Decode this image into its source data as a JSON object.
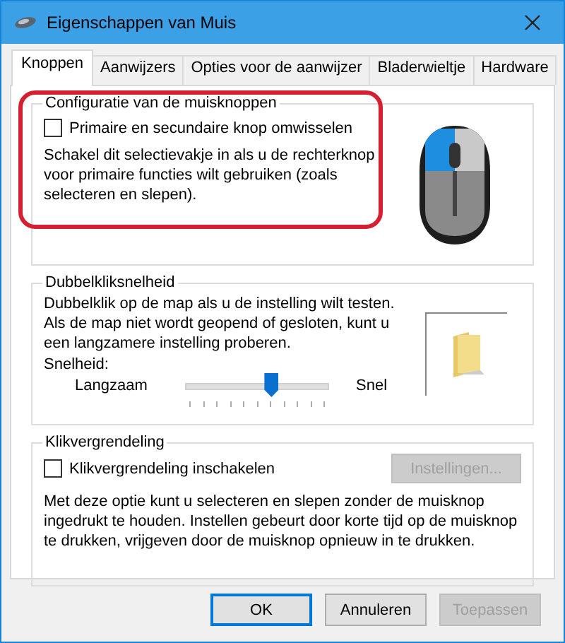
{
  "window": {
    "title": "Eigenschappen van Muis"
  },
  "tabs": [
    {
      "label": "Knoppen",
      "selected": true
    },
    {
      "label": "Aanwijzers",
      "selected": false
    },
    {
      "label": "Opties voor de aanwijzer",
      "selected": false
    },
    {
      "label": "Bladerwieltje",
      "selected": false
    },
    {
      "label": "Hardware",
      "selected": false
    }
  ],
  "button_configuration": {
    "title": "Configuratie van de muisknoppen",
    "checkbox": {
      "label": "Primaire en secundaire knop omwisselen",
      "checked": false
    },
    "description": "Schakel dit selectievakje in als u de rechterknop voor primaire functies wilt gebruiken (zoals selecteren en slepen)."
  },
  "double_click_speed": {
    "title": "Dubbelkliksnelheid",
    "description": "Dubbelklik op de map als u de instelling wilt testen. Als de map niet wordt geopend of gesloten, kunt u een langzamere instelling proberen.",
    "speed_label": "Snelheid:",
    "slow_label": "Langzaam",
    "fast_label": "Snel",
    "level": 0.6
  },
  "click_lock": {
    "title": "Klikvergrendeling",
    "checkbox": {
      "label": "Klikvergrendeling inschakelen",
      "checked": false
    },
    "settings_button": {
      "label": "Instellingen...",
      "disabled": true
    },
    "description": "Met deze optie kunt u selecteren en slepen zonder de muisknop ingedrukt te houden. Instellen gebeurt door korte tijd op de muisknop te drukken, vrijgeven door de muisknop opnieuw in te drukken."
  },
  "buttons": [
    {
      "label": "OK",
      "kind": "default",
      "disabled": false
    },
    {
      "label": "Annuleren",
      "kind": "normal",
      "disabled": false
    },
    {
      "label": "Toepassen",
      "kind": "normal",
      "disabled": true
    }
  ]
}
